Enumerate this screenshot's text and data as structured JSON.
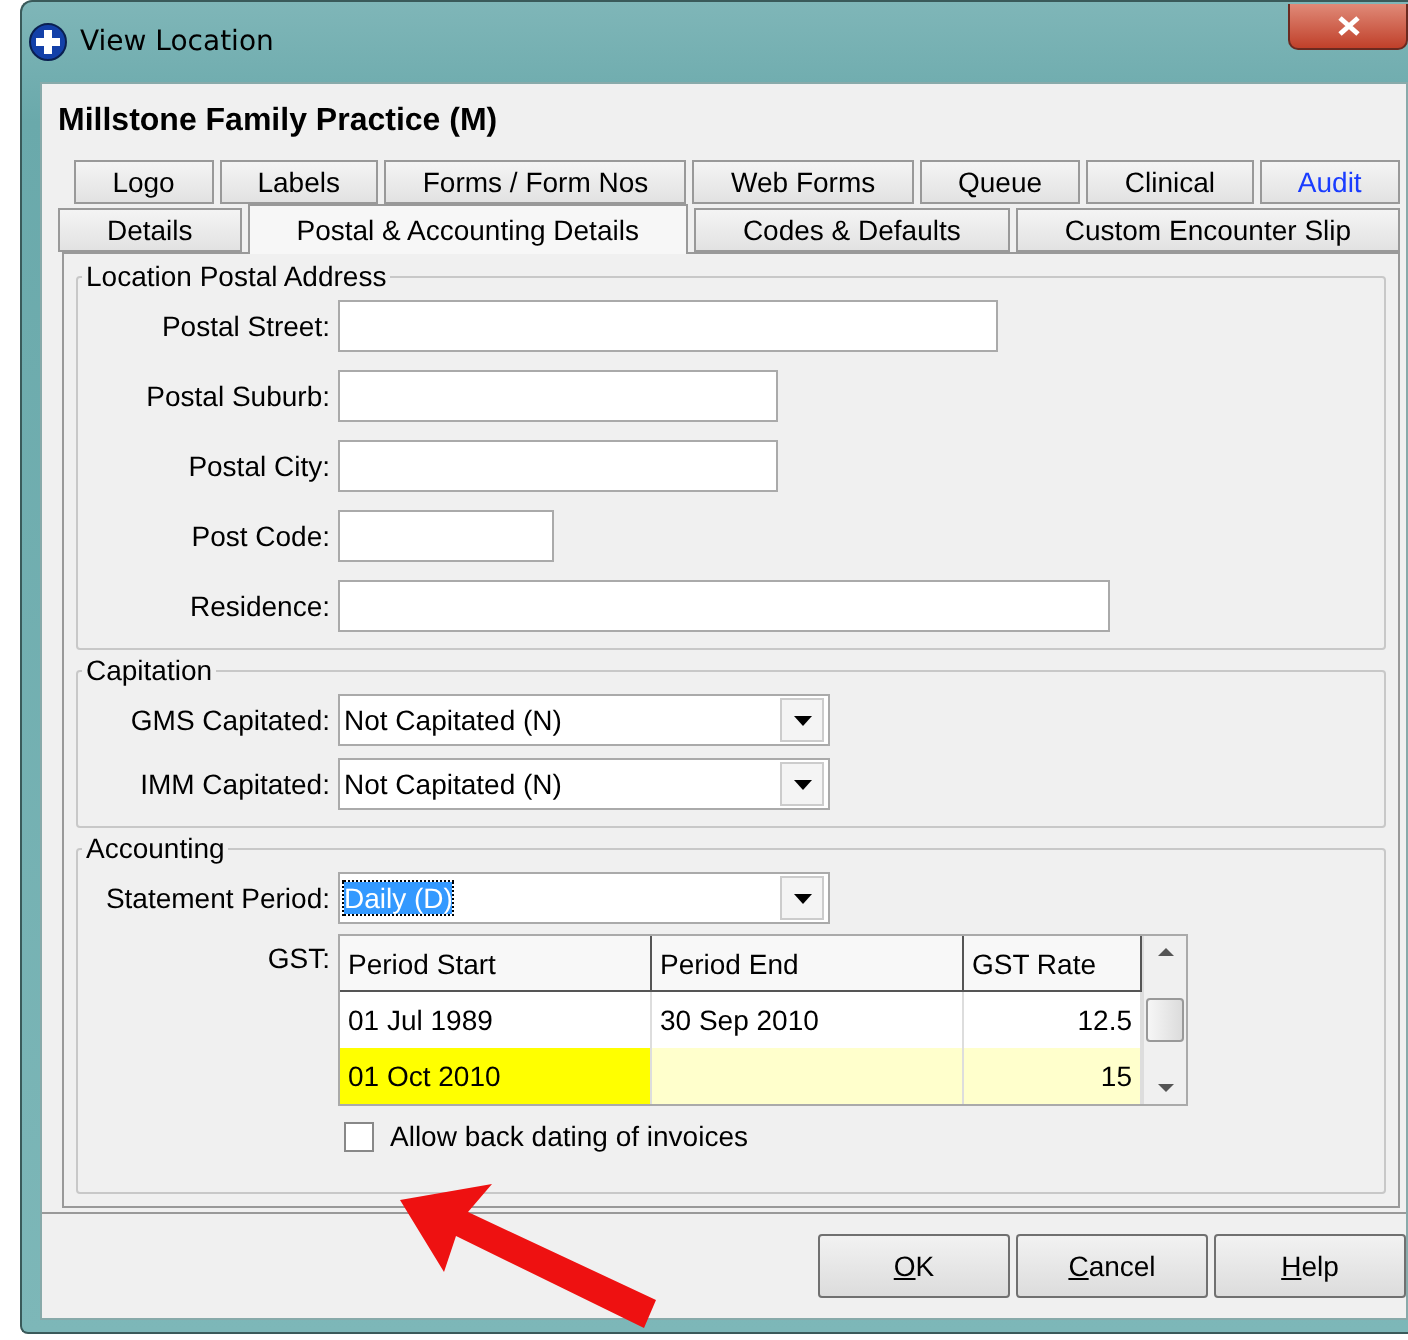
{
  "window": {
    "title": "View Location"
  },
  "header": "Millstone Family Practice (M)",
  "tab_rows": [
    [
      {
        "label": "Logo",
        "selected": false,
        "highlighted": false
      },
      {
        "label": "Labels",
        "selected": false,
        "highlighted": false
      },
      {
        "label": "Forms / Form Nos",
        "selected": false,
        "highlighted": false
      },
      {
        "label": "Web Forms",
        "selected": false,
        "highlighted": false
      },
      {
        "label": "Queue",
        "selected": false,
        "highlighted": false
      },
      {
        "label": "Clinical",
        "selected": false,
        "highlighted": false
      },
      {
        "label": "Audit",
        "selected": false,
        "highlighted": true
      }
    ],
    [
      {
        "label": "Details",
        "selected": false,
        "highlighted": false
      },
      {
        "label": "Postal & Accounting Details",
        "selected": true,
        "highlighted": false
      },
      {
        "label": "Codes & Defaults",
        "selected": false,
        "highlighted": false
      },
      {
        "label": "Custom Encounter Slip",
        "selected": false,
        "highlighted": false
      }
    ]
  ],
  "postal": {
    "title": "Location Postal Address",
    "fields": [
      {
        "label": "Postal Street:"
      },
      {
        "label": "Postal Suburb:"
      },
      {
        "label": "Postal City:"
      },
      {
        "label": "Post Code:"
      },
      {
        "label": "Residence:"
      }
    ]
  },
  "capitation": {
    "title": "Capitation",
    "fields": [
      {
        "label": "GMS Capitated:",
        "value": "Not Capitated (N)",
        "focused": false
      },
      {
        "label": "IMM Capitated:",
        "value": "Not Capitated (N)",
        "focused": false
      }
    ]
  },
  "accounting": {
    "title": "Accounting",
    "statement_period": {
      "label": "Statement Period:",
      "value": "Daily (D)",
      "focused": true
    },
    "gst": {
      "label": "GST:",
      "columns": [
        "Period Start",
        "Period End",
        "GST Rate"
      ],
      "rows": [
        {
          "cells": [
            "01 Jul 1989",
            "30 Sep 2010",
            "12.5"
          ],
          "selected": false
        },
        {
          "cells": [
            "01 Oct 2010",
            "",
            "15"
          ],
          "selected": true
        }
      ]
    },
    "allow_back_dating": {
      "label": "Allow back dating of invoices",
      "checked": false
    }
  },
  "buttons": [
    "OK",
    "Cancel",
    "Help"
  ]
}
